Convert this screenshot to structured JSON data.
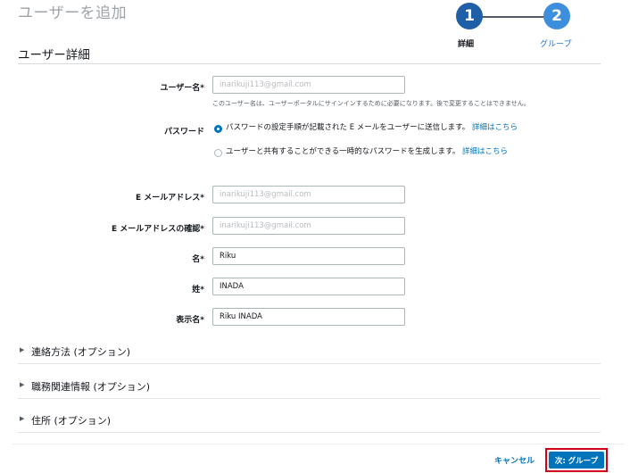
{
  "page": {
    "title": "ユーザーを追加"
  },
  "wizard": {
    "steps": [
      {
        "number": "1",
        "label": "詳細"
      },
      {
        "number": "2",
        "label": "グループ"
      }
    ]
  },
  "section": {
    "title": "ユーザー詳細"
  },
  "form": {
    "username": {
      "label": "ユーザー名*",
      "value": "inarikuji113@gmail.com",
      "hint": "このユーザー名は、ユーザーポータルにサインインするために必要になります。後で変更することはできません。"
    },
    "password": {
      "label": "パスワード",
      "options": [
        {
          "text": "パスワードの設定手順が記載された E メールをユーザーに送信します。",
          "link": "詳細はこちら",
          "checked": true
        },
        {
          "text": "ユーザーと共有することができる一時的なパスワードを生成します。",
          "link": "詳細はこちら",
          "checked": false
        }
      ]
    },
    "email": {
      "label": "E メールアドレス*",
      "value": "inarikuji113@gmail.com"
    },
    "email_confirm": {
      "label": "E メールアドレスの確認*",
      "value": "inarikuji113@gmail.com"
    },
    "first_name": {
      "label": "名*",
      "value": "Riku"
    },
    "last_name": {
      "label": "姓*",
      "value": "INADA"
    },
    "display_name": {
      "label": "表示名*",
      "value": "Riku INADA"
    }
  },
  "collapsibles": [
    {
      "label": "連絡方法 (オプション)"
    },
    {
      "label": "職務関連情報 (オプション)"
    },
    {
      "label": "住所 (オプション)"
    }
  ],
  "footer": {
    "cancel": "キャンセル",
    "next": "次: グループ"
  },
  "colors": {
    "accent": "#0073bb",
    "step1": "#1f5fa8",
    "step2": "#3d8fde",
    "highlight": "#d0021b"
  }
}
